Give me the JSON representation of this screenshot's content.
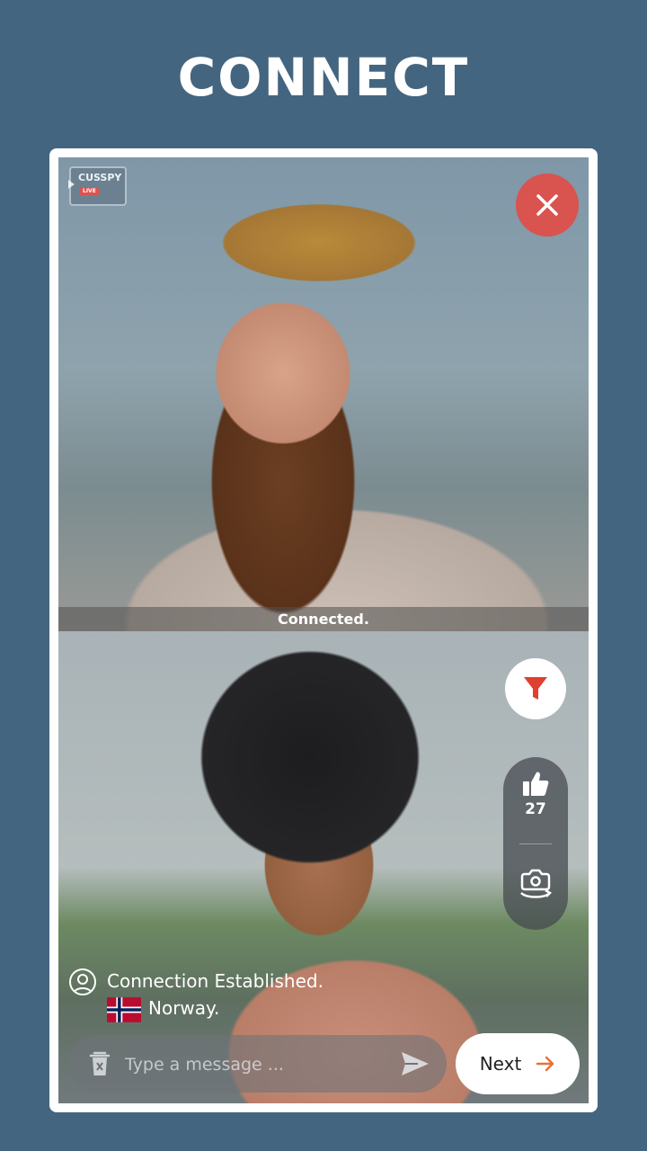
{
  "headline": "CONNECT",
  "app": {
    "logo_text": "CUSSPY",
    "logo_badge": "LIVE"
  },
  "remote_video": {
    "status": "Connected."
  },
  "controls": {
    "close_icon": "close-icon",
    "filter_icon": "filter-icon",
    "like_icon": "thumbs-up-icon",
    "like_count": "27",
    "switch_camera_icon": "switch-camera-icon"
  },
  "connection": {
    "message": "Connection Established.",
    "country": "Norway.",
    "country_flag": "norway-flag"
  },
  "chat": {
    "placeholder": "Type a message ...",
    "clear_icon": "trash-icon",
    "send_icon": "send-icon"
  },
  "next_button": {
    "label": "Next",
    "icon": "arrow-right-icon"
  },
  "colors": {
    "background": "#446580",
    "close_red": "#d9534f",
    "accent_orange": "#e8703a",
    "filter_red": "#e0402f"
  }
}
